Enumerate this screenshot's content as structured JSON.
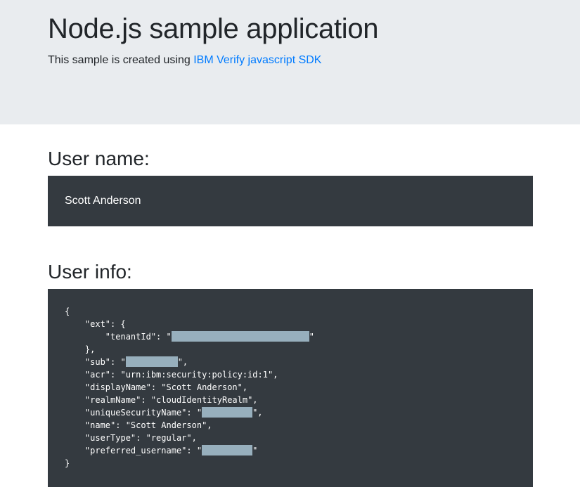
{
  "header": {
    "title": "Node.js sample application",
    "lead_text": "This sample is created using ",
    "sdk_link_label": "IBM Verify javascript SDK"
  },
  "user_name_section": {
    "heading": "User name:",
    "value": "Scott Anderson"
  },
  "user_info_section": {
    "heading": "User info:",
    "json_lines": {
      "open_brace": "{",
      "ext_open": "    \"ext\": {",
      "tenant_prefix": "        \"tenantId\": \"",
      "tenant_suffix": "\"",
      "ext_close": "    },",
      "sub_prefix": "    \"sub\": \"",
      "sub_suffix": "\",",
      "acr": "    \"acr\": \"urn:ibm:security:policy:id:1\",",
      "displayName": "    \"displayName\": \"Scott Anderson\",",
      "realmName": "    \"realmName\": \"cloudIdentityRealm\",",
      "unique_prefix": "    \"uniqueSecurityName\": \"",
      "unique_suffix": "\",",
      "name": "    \"name\": \"Scott Anderson\",",
      "userType": "    \"userType\": \"regular\",",
      "pref_prefix": "    \"preferred_username\": \"",
      "pref_suffix": "\"",
      "close_brace": "}"
    }
  },
  "colors": {
    "jumbotron_bg": "#e9ecef",
    "dark_box_bg": "#343a40",
    "link": "#007bff",
    "redaction": "#97afbd"
  }
}
